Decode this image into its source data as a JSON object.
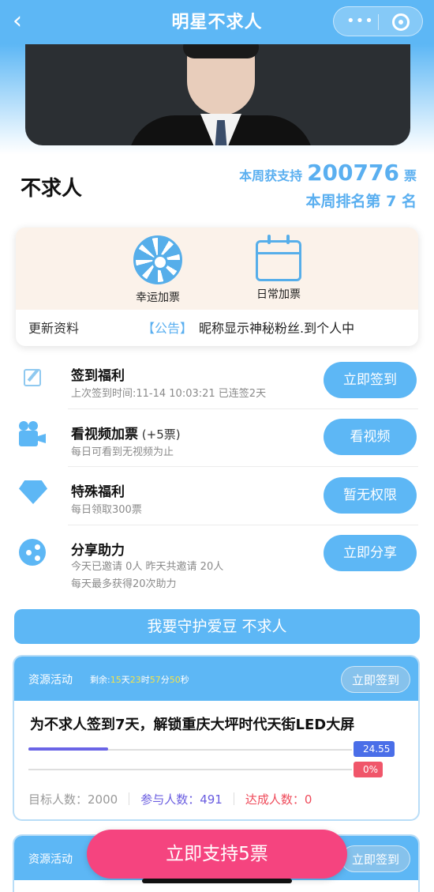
{
  "header": {
    "title": "明星不求人",
    "back_icon": "chevron-left-icon",
    "more_icon": "more-dots-icon",
    "close_icon": "target-close-icon"
  },
  "profile": {
    "name": "不求人",
    "weekly_support_prefix": "本周获支持",
    "weekly_support_value": "200776",
    "weekly_support_unit": "票",
    "weekly_rank": "本周排名第 7 名"
  },
  "features": {
    "lucky_label": "幸运加票",
    "daily_label": "日常加票",
    "marquee_left": "更新资料",
    "marquee_tag": "【公告】",
    "marquee_text": "昵称显示神秘粉丝.到个人中"
  },
  "tasks": [
    {
      "name": "签到福利",
      "name_sub": "",
      "desc1": "上次签到时间:11-14 10:03:21 已连签2天",
      "desc2": "",
      "button": "立即签到",
      "icon": "edit-icon"
    },
    {
      "name": "看视频加票",
      "name_sub": " (+5票)",
      "desc1": "每日可看到无视频为止",
      "desc2": "",
      "button": "看视频",
      "icon": "video-camera-icon"
    },
    {
      "name": "特殊福利",
      "name_sub": "",
      "desc1": "每日领取300票",
      "desc2": "",
      "button": "暂无权限",
      "icon": "diamond-icon"
    },
    {
      "name": "分享助力",
      "name_sub": "",
      "desc1": "今天已邀请 0人 昨天共邀请 20人",
      "desc2": "每天最多获得20次助力",
      "button": "立即分享",
      "icon": "share-icon"
    }
  ],
  "guard_label": "我要守护爱豆 不求人",
  "resource_cards": [
    {
      "head": "资源活动",
      "countdown_prefix": "剩余:",
      "cd_days": "15",
      "cd_days_unit": "天",
      "cd_hours": "23",
      "cd_hours_unit": "时",
      "cd_mins": "57",
      "cd_mins_unit": "分",
      "cd_secs": "50",
      "cd_secs_unit": "秒",
      "button": "立即签到",
      "title": "为不求人签到7天，解锁重庆大坪时代天街LED大屏",
      "progress_blue_label": "24.55",
      "progress_blue": 0.2455,
      "progress_red_label": "0%",
      "progress_red": 0,
      "target_label": "目标人数：2000",
      "participants_label": "参与人数：491",
      "achieved_label": "达成人数：0"
    },
    {
      "head": "资源活动",
      "button": "立即签到"
    }
  ],
  "cta_label": "立即支持5票",
  "colors": {
    "primary": "#5db7f5",
    "cta": "#f5447f",
    "progress": "#6a64e6",
    "red": "#ef4a5a"
  }
}
